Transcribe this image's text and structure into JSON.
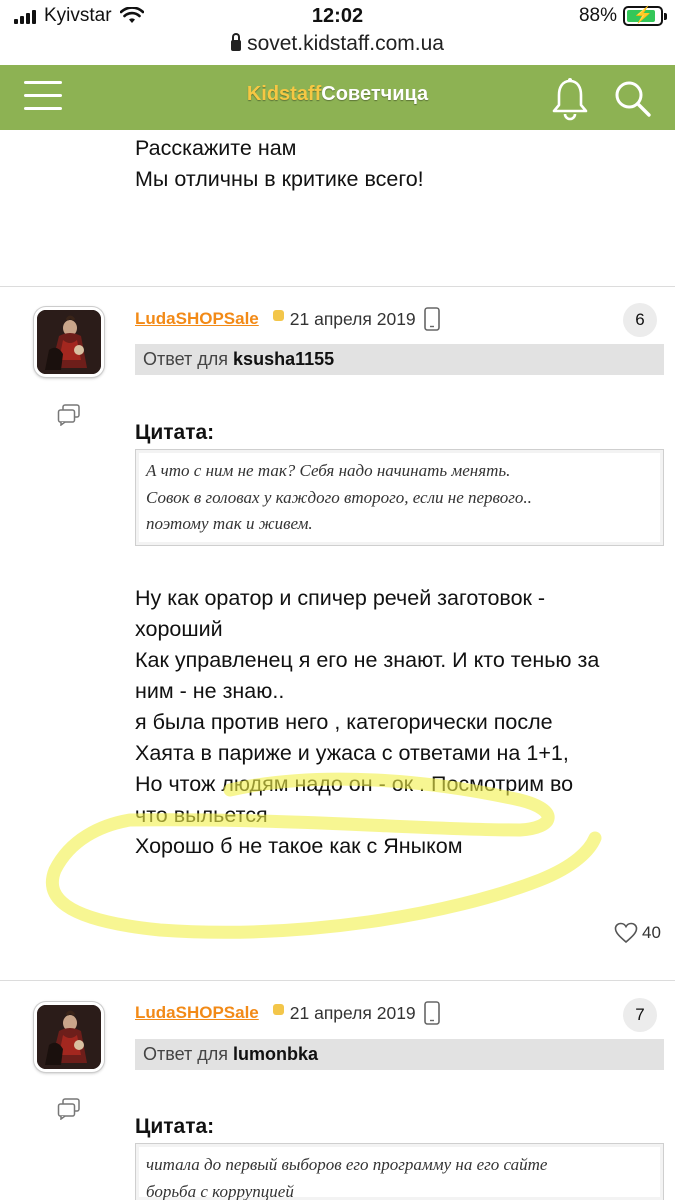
{
  "status_bar": {
    "carrier": "Kyivstar",
    "time": "12:02",
    "battery": "88%",
    "battery_level": 0.88
  },
  "browser": {
    "url": "sovet.kidstaff.com.ua"
  },
  "header": {
    "logo_part1": "Kidstaff",
    "logo_part2": "Советчица",
    "accent_color": "#8db253"
  },
  "previous_post": {
    "lines": [
      "Расскажите нам",
      "Мы отличны в критике всего!"
    ]
  },
  "posts": [
    {
      "author": "LudaSHOPSale",
      "date": "21 апреля 2019",
      "number": "6",
      "reply_prefix": "Ответ для",
      "reply_to": "ksusha1155",
      "quote_title": "Цитата:",
      "quote_lines": [
        "А что с ним не так? Себя надо начинать менять.",
        "Совок в головах у каждого второго, если не первого..",
        "поэтому так и живем."
      ],
      "body_lines": [
        "Ну как оратор и спичер речей заготовок -",
        "хороший",
        "Как управленец я его не знают. И кто тенью за",
        "ним - не знаю..",
        "я была против него , категорически после",
        "Хаята в париже и ужаса с ответами на 1+1,",
        "Но чтож людям надо он - ок . Посмотрим во",
        "что выльется",
        "Хорошо б не такое как с Яныком"
      ],
      "likes": "40"
    },
    {
      "author": "LudaSHOPSale",
      "date": "21 апреля 2019",
      "number": "7",
      "reply_prefix": "Ответ для",
      "reply_to": "lumonbka",
      "quote_title": "Цитата:",
      "quote_lines": [
        "читала до первый выборов его программу на его сайте",
        "борьба с коррупцией"
      ]
    }
  ]
}
